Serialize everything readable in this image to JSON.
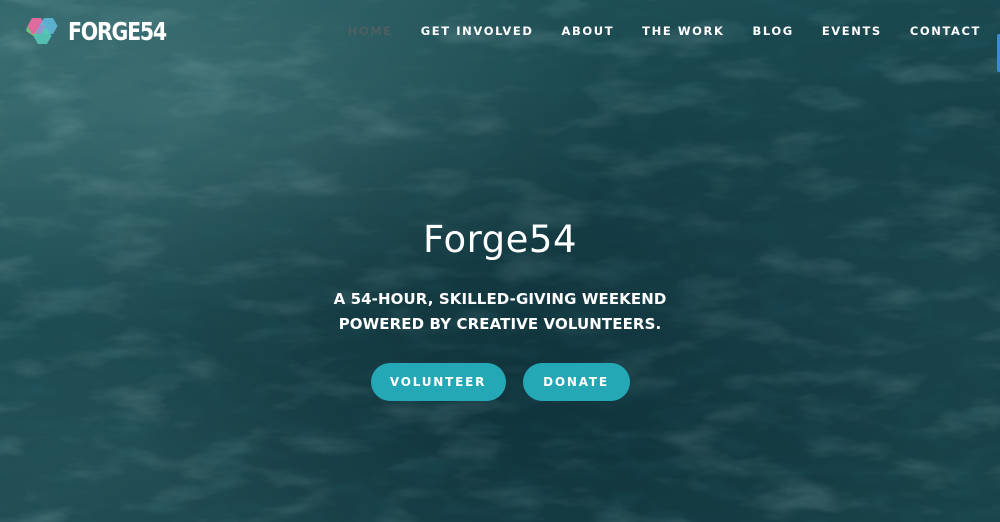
{
  "brand": {
    "name": "FORGE54",
    "logo_icon": "hexagon-cube-icon"
  },
  "nav": {
    "items": [
      {
        "label": "HOME",
        "active": true
      },
      {
        "label": "GET INVOLVED",
        "active": false
      },
      {
        "label": "ABOUT",
        "active": false
      },
      {
        "label": "THE WORK",
        "active": false
      },
      {
        "label": "BLOG",
        "active": false
      },
      {
        "label": "EVENTS",
        "active": false
      },
      {
        "label": "CONTACT",
        "active": false
      }
    ]
  },
  "hero": {
    "title": "Forge54",
    "subtitle_line1": "A 54-HOUR, SKILLED-GIVING WEEKEND",
    "subtitle_line2": "POWERED BY CREATIVE VOLUNTEERS.",
    "volunteer_label": "VOLUNTEER",
    "donate_label": "DONATE"
  },
  "colors": {
    "background": "#1d4e54",
    "button": "#24a8b6",
    "nav_active": "#4c5f62",
    "edge_tab": "#3a8ccf"
  }
}
